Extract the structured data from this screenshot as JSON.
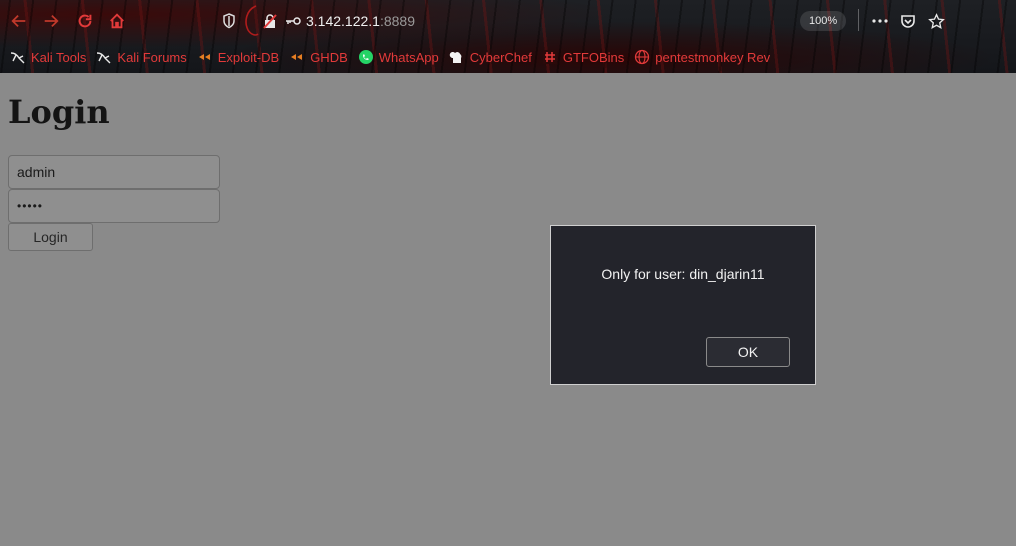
{
  "browser": {
    "url_host": "3.142.122.1",
    "url_port": ":8889",
    "zoom": "100%",
    "bookmarks": [
      {
        "label": "Kali Tools",
        "icon": "kali-dragon-icon"
      },
      {
        "label": "Kali Forums",
        "icon": "kali-dragon-icon"
      },
      {
        "label": "Exploit-DB",
        "icon": "exploit-db-icon"
      },
      {
        "label": "GHDB",
        "icon": "ghdb-icon"
      },
      {
        "label": "WhatsApp",
        "icon": "whatsapp-icon"
      },
      {
        "label": "CyberChef",
        "icon": "cyberchef-icon"
      },
      {
        "label": "GTFOBins",
        "icon": "gtfobins-icon"
      },
      {
        "label": "pentestmonkey Rev",
        "icon": "globe-icon"
      }
    ]
  },
  "page": {
    "title": "Login",
    "username_value": "admin",
    "password_value": "•••••",
    "login_button": "Login"
  },
  "dialog": {
    "message": "Only for user: din_djarin11",
    "ok_label": "OK"
  },
  "colors": {
    "bookmark_text": "#e23a3a",
    "page_background": "#8a8a8a",
    "dialog_background": "#23242b"
  }
}
